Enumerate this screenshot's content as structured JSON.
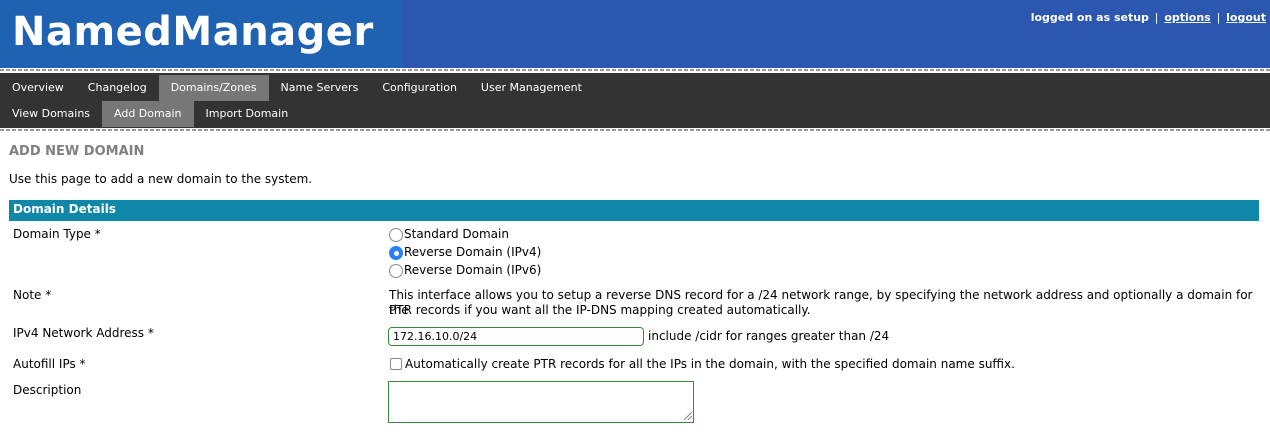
{
  "header": {
    "logo": "NamedManager",
    "logged_on_text": "logged on as setup",
    "separator": "|",
    "options_link": "options",
    "logout_link": "logout",
    "colors": {
      "header_bg": "#2b57b0",
      "logo_bg": "#1f62b2"
    }
  },
  "nav": {
    "main": [
      {
        "label": "Overview",
        "active": false
      },
      {
        "label": "Changelog",
        "active": false
      },
      {
        "label": "Domains/Zones",
        "active": true
      },
      {
        "label": "Name Servers",
        "active": false
      },
      {
        "label": "Configuration",
        "active": false
      },
      {
        "label": "User Management",
        "active": false
      }
    ],
    "sub": [
      {
        "label": "View Domains",
        "active": false
      },
      {
        "label": "Add Domain",
        "active": true
      },
      {
        "label": "Import Domain",
        "active": false
      }
    ]
  },
  "page": {
    "title": "ADD NEW DOMAIN",
    "intro": "Use this page to add a new domain to the system."
  },
  "form": {
    "section_title": "Domain Details",
    "section_color": "#0e87a8",
    "domain_type": {
      "label": "Domain Type *",
      "options": [
        {
          "label": "Standard Domain",
          "checked": false
        },
        {
          "label": "Reverse Domain (IPv4)",
          "checked": true
        },
        {
          "label": "Reverse Domain (IPv6)",
          "checked": false
        }
      ]
    },
    "note": {
      "label": "Note *",
      "line1": "This interface allows you to setup a reverse DNS record for a /24 network range, by specifying the network address and optionally a domain for the",
      "line2": "PTR records if you want all the IP-DNS mapping created automatically."
    },
    "ipv4": {
      "label": "IPv4 Network Address *",
      "value": "172.16.10.0/24",
      "hint": "include /cidr for ranges greater than /24"
    },
    "autofill": {
      "label": "Autofill IPs *",
      "checked": false,
      "text": "Automatically create PTR records for all the IPs in the domain, with the specified domain name suffix."
    },
    "description": {
      "label": "Description",
      "value": ""
    }
  }
}
